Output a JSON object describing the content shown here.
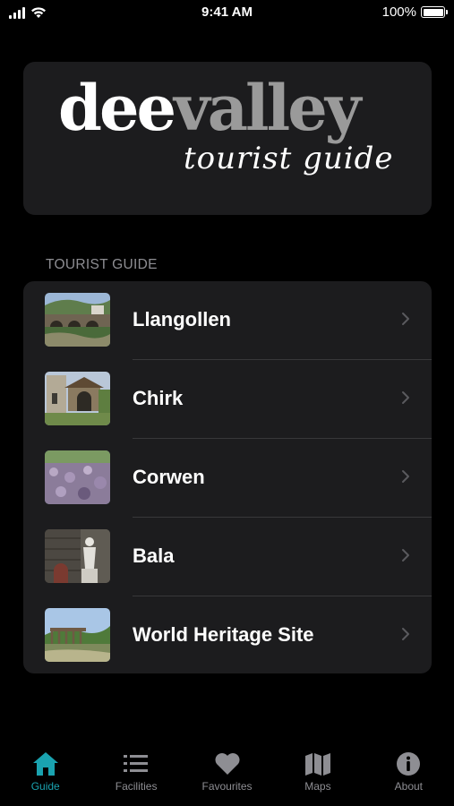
{
  "status_bar": {
    "time": "9:41 AM",
    "battery": "100%"
  },
  "logo": {
    "word_dee": "dee",
    "word_valley": "valley",
    "subtitle": "tourist guide"
  },
  "section": {
    "header": "TOURIST GUIDE"
  },
  "guide_items": [
    {
      "label": "Llangollen",
      "thumb": "llangollen-photo"
    },
    {
      "label": "Chirk",
      "thumb": "chirk-photo"
    },
    {
      "label": "Corwen",
      "thumb": "corwen-photo"
    },
    {
      "label": "Bala",
      "thumb": "bala-photo"
    },
    {
      "label": "World Heritage Site",
      "thumb": "world-heritage-site-photo"
    }
  ],
  "tabs": [
    {
      "label": "Guide",
      "icon": "home-icon",
      "active": true
    },
    {
      "label": "Facilities",
      "icon": "list-icon",
      "active": false
    },
    {
      "label": "Favourites",
      "icon": "heart-icon",
      "active": false
    },
    {
      "label": "Maps",
      "icon": "map-icon",
      "active": false
    },
    {
      "label": "About",
      "icon": "info-icon",
      "active": false
    }
  ],
  "colors": {
    "accent": "#1aa3b0",
    "card_bg": "#1c1c1e",
    "inactive": "#8e8e93"
  }
}
